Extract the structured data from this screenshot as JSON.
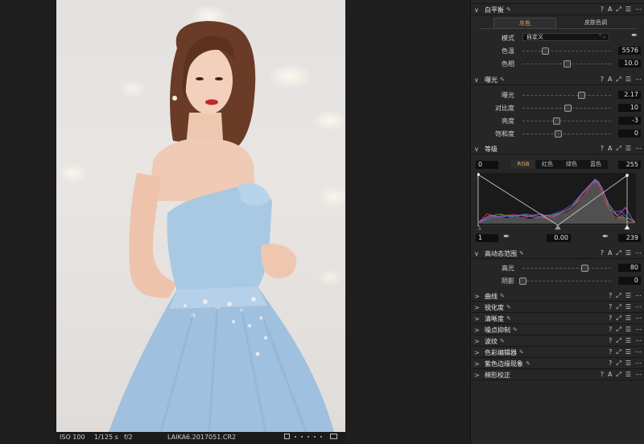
{
  "viewer": {
    "status": {
      "iso": "ISO 100",
      "shutter": "1/125 s",
      "aperture": "f/2",
      "filename": "LAIKA6.2017051.CR2"
    }
  },
  "panel": {
    "head_actions": [
      "?",
      "A",
      "⤢",
      "☰",
      "⋯"
    ],
    "white_balance": {
      "title": "白平衡",
      "tabs": [
        "灰色",
        "皮肤色调"
      ],
      "mode_label": "模式",
      "mode_value": "自定义",
      "rows": [
        {
          "label": "色温",
          "value": "5576",
          "pos": 0.25
        },
        {
          "label": "色相",
          "value": "10.0",
          "pos": 0.5
        }
      ]
    },
    "exposure": {
      "title": "曝光",
      "rows": [
        {
          "label": "曝光",
          "value": "2.17",
          "pos": 0.66
        },
        {
          "label": "对比度",
          "value": "10",
          "pos": 0.51
        },
        {
          "label": "亮度",
          "value": "-3",
          "pos": 0.38
        },
        {
          "label": "饱和度",
          "value": "0",
          "pos": 0.4
        }
      ]
    },
    "levels": {
      "title": "等级",
      "tabs": [
        "RGB",
        "红色",
        "绿色",
        "蓝色"
      ],
      "output_low": "0",
      "output_high": "255",
      "input_low": "1",
      "midtone": "0.00",
      "input_high": "239"
    },
    "hdr": {
      "title": "高动态范围",
      "rows": [
        {
          "label": "高光",
          "value": "80",
          "pos": 0.7
        },
        {
          "label": "阴影",
          "value": "0",
          "pos": 0.0
        }
      ]
    },
    "collapsed_tools": [
      "曲线",
      "锐化度",
      "清晰度",
      "噪点抑制",
      "波纹",
      "色彩编辑器",
      "紫色边缘现象",
      "梯形校正"
    ]
  }
}
